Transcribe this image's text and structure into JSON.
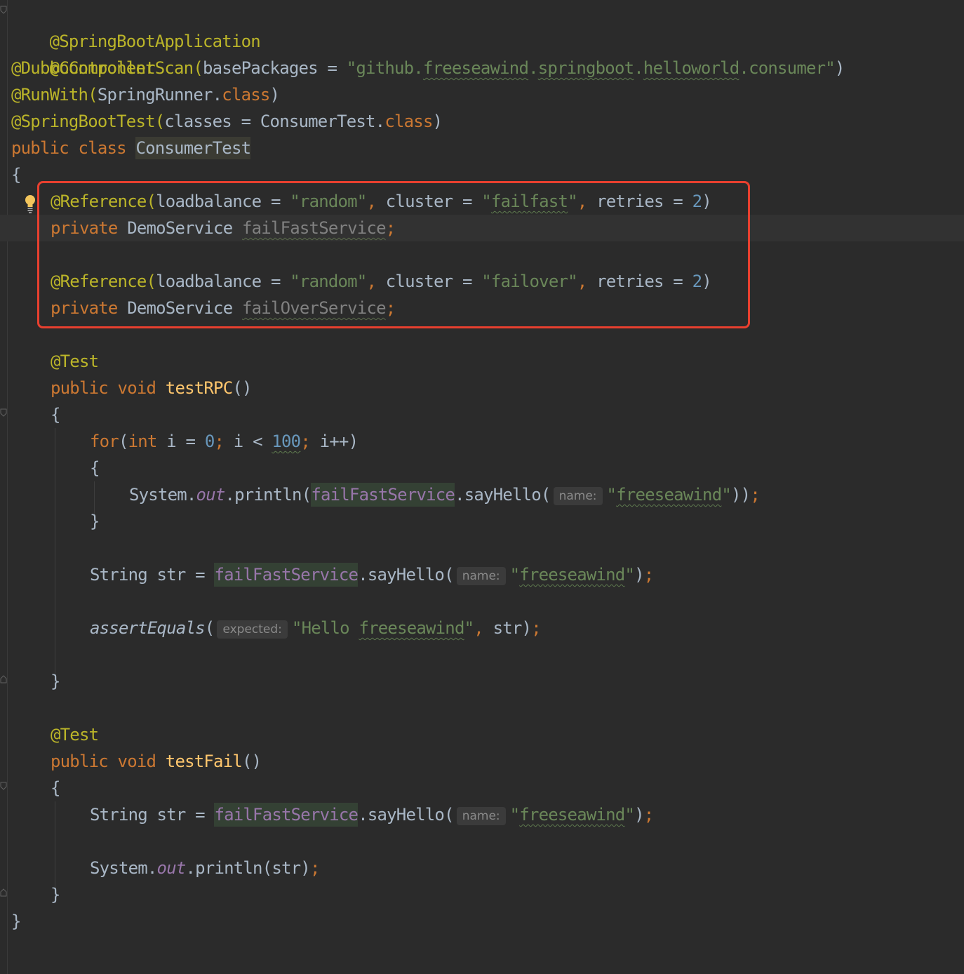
{
  "code": {
    "line1_annotation": "@SpringBootApplication",
    "line2_annotation": "@Controller",
    "line3": {
      "annotation": "@DubboComponentScan(",
      "param": "basePackages",
      "eq": " = ",
      "str_open": "\"github.",
      "seg1": "freeseawind",
      "dot1": ".",
      "seg2": "springboot",
      "dot2": ".",
      "seg3": "helloworld",
      "str_close": ".consumer\"",
      "close": ")"
    },
    "line4": {
      "annotation": "@RunWith(",
      "cls": "SpringRunner.",
      "kw": "class",
      "close": ")"
    },
    "line5": {
      "annotation": "@SpringBootTest(",
      "param": "classes",
      "eq": " = ",
      "cls": "ConsumerTest.",
      "kw": "class",
      "close": ")"
    },
    "line6": {
      "kw": "public class ",
      "name": "ConsumerTest"
    },
    "open_brace": "{",
    "ref1": {
      "annotation": "@Reference(",
      "p1": "loadbalance",
      "eq1": " = ",
      "v1": "\"random\"",
      "comma1": ", ",
      "p2": "cluster",
      "eq2": " = ",
      "v2_open": "\"",
      "v2_word": "failfast",
      "v2_close": "\"",
      "comma2": ", ",
      "p3": "retries",
      "eq3": " = ",
      "v3": "2",
      "close": ")"
    },
    "field1": {
      "kw": "private ",
      "type": "DemoService ",
      "name": "failFastService",
      "semi": ";"
    },
    "ref2": {
      "annotation": "@Reference(",
      "p1": "loadbalance",
      "eq1": " = ",
      "v1": "\"random\"",
      "comma1": ", ",
      "p2": "cluster",
      "eq2": " = ",
      "v2": "\"failover\"",
      "comma2": ", ",
      "p3": "retries",
      "eq3": " = ",
      "v3": "2",
      "close": ")"
    },
    "field2": {
      "kw": "private ",
      "type": "DemoService ",
      "name": "failOverService",
      "semi": ";"
    },
    "test1_annotation": "@Test",
    "test1_sig": {
      "kw": "public void ",
      "name": "testRPC",
      "parens": "()"
    },
    "brace_open": "{",
    "brace_close": "}",
    "for_line": {
      "kw1": "for",
      "p1": "(",
      "kw2": "int",
      "a": " i = ",
      "zero": "0",
      "semi1": ";",
      "b": " i < ",
      "hundred": "100",
      "semi2": ";",
      "c": " i++)"
    },
    "println1": {
      "a": "System.",
      "out": "out",
      "b": ".println(",
      "field": "failFastService",
      "c": ".sayHello(",
      "hint": "name:",
      "str_open": "\"",
      "str_word": "freeseawind",
      "str_close": "\"",
      "d": "))",
      "semi": ";"
    },
    "str_line1": {
      "a": "String str = ",
      "field": "failFastService",
      "c": ".sayHello(",
      "hint": "name:",
      "str_open": "\"",
      "str_word": "freeseawind",
      "str_close": "\"",
      "d": ")",
      "semi": ";"
    },
    "assert_line": {
      "fn": "assertEquals",
      "p": "(",
      "hint": "expected:",
      "str_open": "\"Hello ",
      "str_word": "freeseawind",
      "str_close": "\"",
      "comma": ",",
      "b": " str)",
      "semi": ";"
    },
    "test2_annotation": "@Test",
    "test2_sig": {
      "kw": "public void ",
      "name": "testFail",
      "parens": "()"
    },
    "str_line2": {
      "a": "String str = ",
      "field": "failFastService",
      "c": ".sayHello(",
      "hint": "name:",
      "str_open": "\"",
      "str_word": "freeseawind",
      "str_close": "\"",
      "d": ")",
      "semi": ";"
    },
    "println2": {
      "a": "System.",
      "out": "out",
      "b": ".println(str)",
      "semi": ";"
    }
  },
  "colors": {
    "background": "#2b2b2b",
    "highlight_box": "#e8402f",
    "annotation": "#bbb529",
    "keyword": "#cc7832",
    "string": "#6a8759",
    "number": "#6897bb",
    "text": "#a9b7c6"
  },
  "icons": {
    "intention_bulb": "lightbulb-icon"
  }
}
